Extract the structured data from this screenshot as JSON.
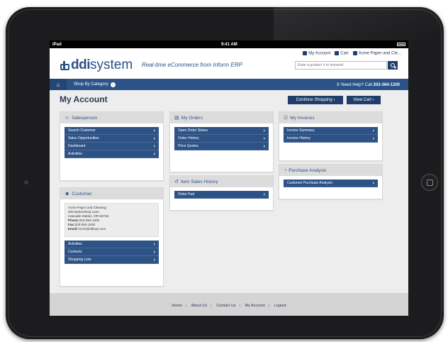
{
  "statusbar": {
    "carrier": "iPad",
    "time": "9:41 AM"
  },
  "header": {
    "logo_bold": "ddi",
    "logo_rest": "system",
    "tagline": "Real-time eCommerce from Inform ERP",
    "my_account": "My Account",
    "cart": "Cart",
    "company": "Acme Paper and Cle...",
    "search_placeholder": "Enter a product # or keyword"
  },
  "nav": {
    "shop_by_category": "Shop By Category",
    "help_prefix": "Need Help? Call ",
    "help_phone": "203-364-1200"
  },
  "page": {
    "title": "My Account",
    "continue_shopping": "Continue Shopping",
    "view_cart": "View Cart"
  },
  "salesperson": {
    "title": "Salesperson",
    "items": [
      "Search Customer",
      "Sales Opportunities",
      "Dashboard",
      "Activities"
    ]
  },
  "customer": {
    "title": "Customer",
    "name": "Acme Paper and Cleaning",
    "address1": "205 Buttonshop Lane",
    "address2": "Cascade Station, OR 90745",
    "phone_label": "Phone:",
    "phone": "203-364-1300",
    "fax_label": "Fax:",
    "fax": "203-364-1200",
    "email_label": "Email:",
    "email": "Acme@ddisys.com",
    "items": [
      "Activities",
      "Contacts",
      "Shopping Lists"
    ]
  },
  "orders": {
    "title": "My Orders",
    "items": [
      "Open Order Status",
      "Order History",
      "Price Quotes"
    ]
  },
  "item_sales": {
    "title": "Item Sales History",
    "items": [
      "Order Pad"
    ]
  },
  "invoices": {
    "title": "My Invoices",
    "items": [
      "Invoice Summary",
      "Invoice History"
    ]
  },
  "purchase": {
    "title": "Purchase Analysis",
    "items": [
      "Customer Purchase Analysis"
    ]
  },
  "footer": {
    "links": [
      "Home",
      "About Us",
      "Contact Us",
      "My Account",
      "Logout"
    ]
  },
  "colors": {
    "brand": "#2b5387",
    "dark": "#1f3f6a",
    "panel_head": "#dcdcdc"
  }
}
